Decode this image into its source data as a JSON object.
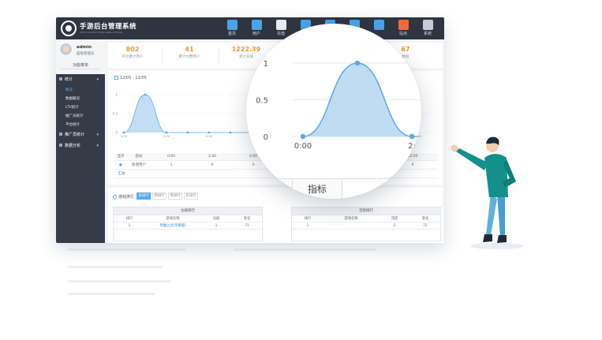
{
  "app": {
    "title": "手游后台管理系统",
    "subtitle": "SHOUYOUHOUTAIGUANLIXITONG"
  },
  "nav": [
    {
      "label": "首页",
      "icon": "grid-icon",
      "color": "#4aa3e8"
    },
    {
      "label": "用户",
      "icon": "user-icon",
      "color": "#4aa3e8"
    },
    {
      "label": "充值",
      "icon": "recharge-icon",
      "color": "#e9ecef"
    },
    {
      "label": "",
      "icon": "globe-icon",
      "color": "#4aa3e8"
    },
    {
      "label": "",
      "icon": "monitor-icon",
      "color": "#4aa3e8"
    },
    {
      "label": "",
      "icon": "map-icon",
      "color": "#4aa3e8"
    },
    {
      "label": "",
      "icon": "stats-icon",
      "color": "#4aa3e8"
    },
    {
      "label": "站点",
      "icon": "site-icon",
      "color": "#f26b3a"
    },
    {
      "label": "系统",
      "icon": "system-icon",
      "color": "#c8ccd6"
    },
    {
      "label": "",
      "icon": "more-icon",
      "color": "#4aa3e8"
    }
  ],
  "user": {
    "name": "admin",
    "role": "超级管理员",
    "menu_button": "功能菜单"
  },
  "sidebar": {
    "group_stats": "统计",
    "sub_items": [
      {
        "label": "概览",
        "active": true
      },
      {
        "label": "数据概况",
        "active": false
      },
      {
        "label": "LTV统计",
        "active": false
      },
      {
        "label": "推广员统计",
        "active": false
      },
      {
        "label": "平台统计",
        "active": false
      }
    ],
    "group_promoter": "推广员统计",
    "group_analysis": "数据分析"
  },
  "stats": [
    {
      "value": "802",
      "label": "平台累计用户"
    },
    {
      "value": "41",
      "label": "累计付费用户"
    },
    {
      "value": "1222.39",
      "label": "累计充值"
    },
    {
      "value": "67",
      "label": "数据"
    }
  ],
  "date_range": "12/05 - 12/05",
  "chart_data": {
    "type": "area",
    "x": [
      "0:00",
      "2:00",
      "4:00",
      "6:00",
      "8:00",
      "10:00",
      "12:00"
    ],
    "values": [
      0,
      1,
      0,
      0,
      0,
      0,
      0
    ],
    "yticks": [
      "0",
      "0.5",
      "1"
    ],
    "ylim": [
      0,
      1
    ],
    "color": "#5aa9e8"
  },
  "mini_table": {
    "headers": [
      "显示",
      "指标",
      "0:00",
      "2:00",
      "4:00",
      "12:00"
    ],
    "row1": [
      "新增用户",
      "1",
      "0",
      "0",
      "0"
    ],
    "row2_label": "汇总"
  },
  "ranking": {
    "title": "游戏排行",
    "tabs": [
      "日排行",
      "周排行",
      "月排行",
      "年排行"
    ],
    "left_table": {
      "title": "注册排行",
      "columns": [
        "排行",
        "游戏名称",
        "注册",
        "变化"
      ],
      "row": [
        "1",
        "神魔之战(苹果版)",
        "1",
        "71"
      ]
    },
    "right_table": {
      "title": "活跃排行",
      "columns": [
        "排行",
        "游戏名称",
        "活跃",
        "变化"
      ],
      "row": [
        "1",
        "",
        "3",
        "72"
      ]
    }
  },
  "magnifier": {
    "tab_label": "指标",
    "x_labels": [
      "0:00",
      "2:"
    ],
    "y_labels": [
      "1",
      "0.5",
      "0"
    ]
  }
}
